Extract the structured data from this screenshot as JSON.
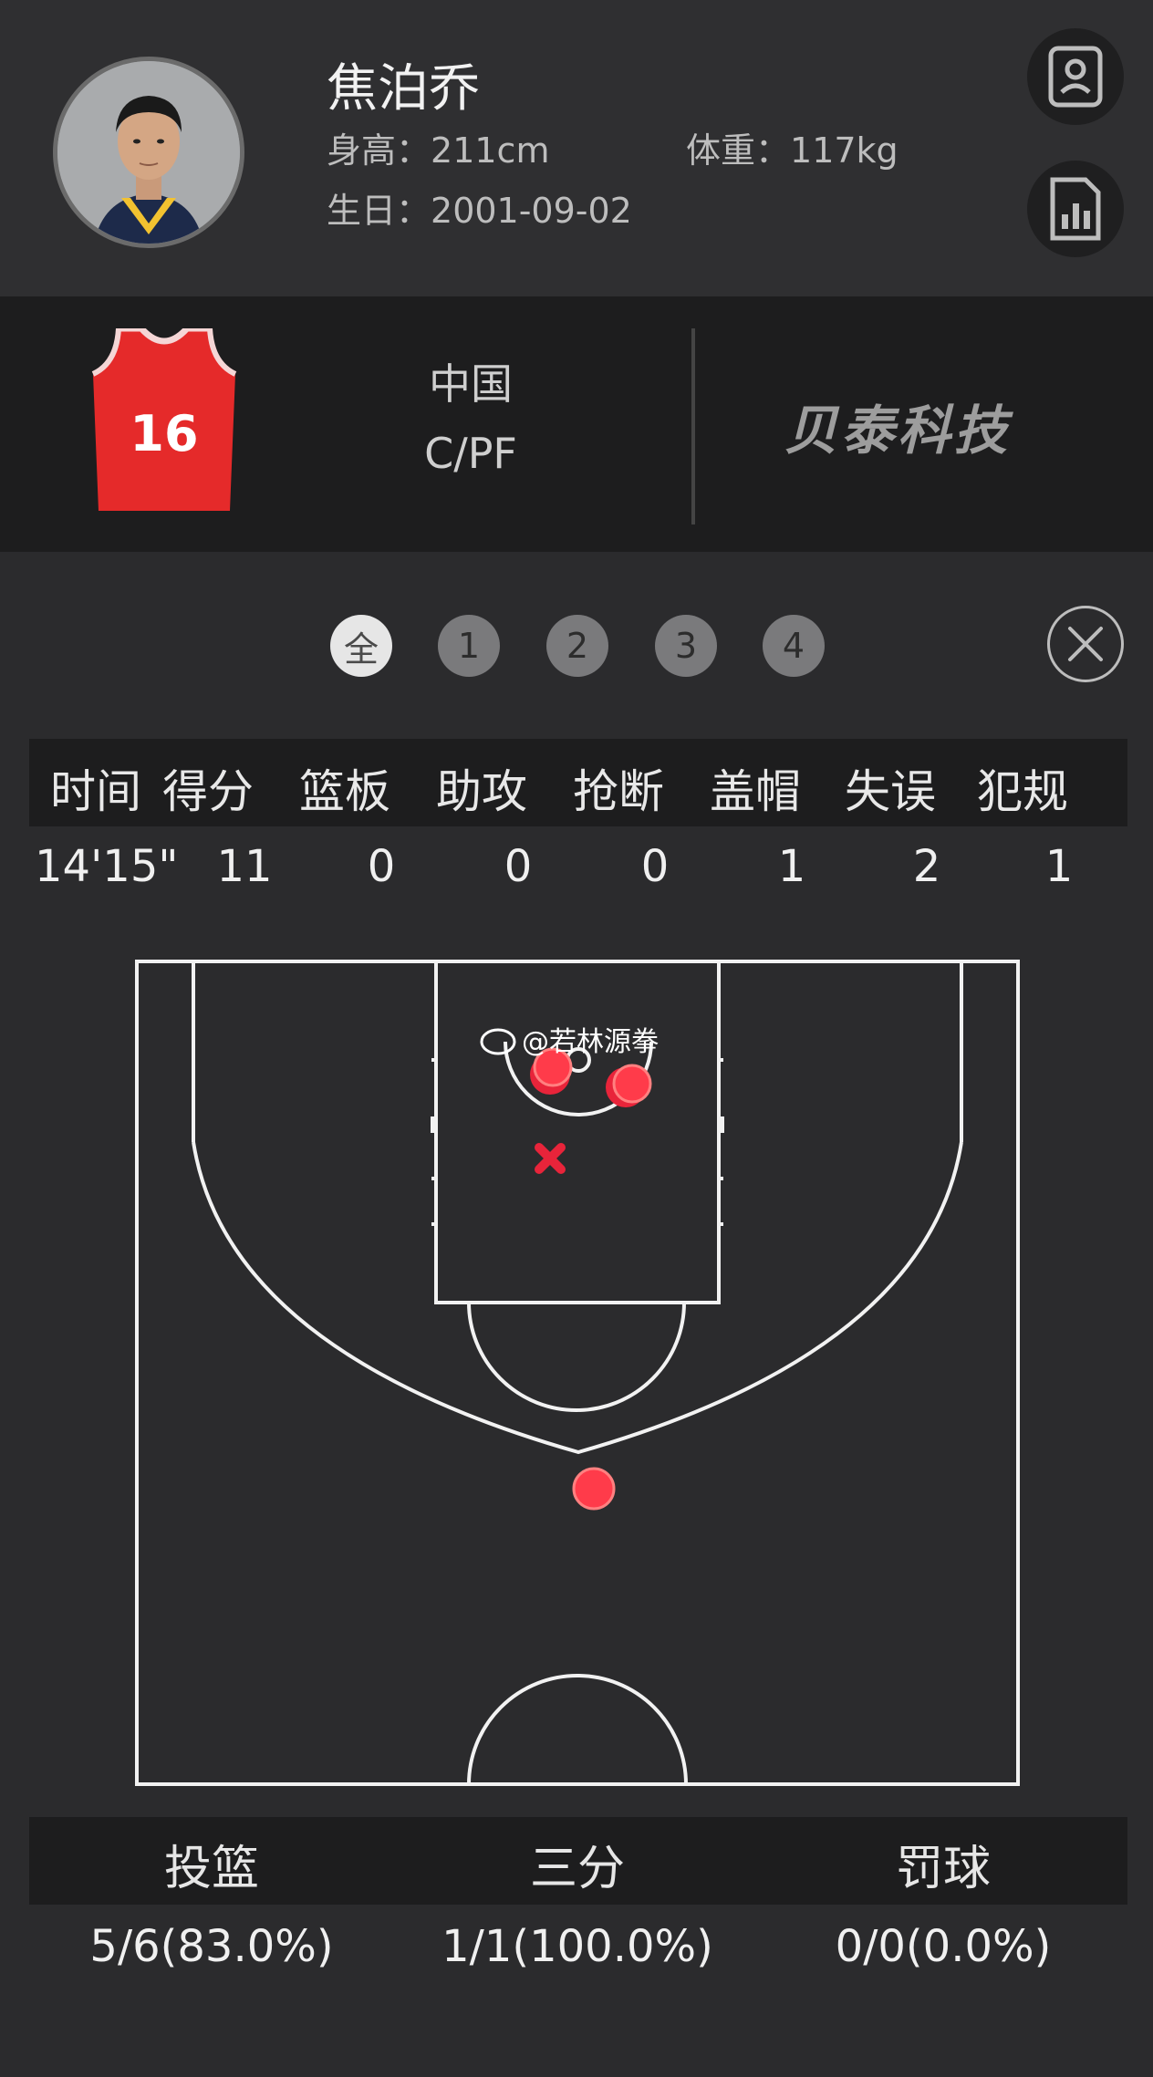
{
  "player": {
    "name": "焦泊乔",
    "height_label": "身高：",
    "height": "211cm",
    "weight_label": "体重：",
    "weight": "117kg",
    "birthday_label": "生日：",
    "birthday": "2001-09-02",
    "jersey_number": "16",
    "country": "中国",
    "position": "C/PF"
  },
  "brand": "贝泰科技",
  "quarter_tabs": [
    "全",
    "1",
    "2",
    "3",
    "4"
  ],
  "active_tab": "全",
  "stats": {
    "headers": [
      "时间",
      "得分",
      "篮板",
      "助攻",
      "抢断",
      "盖帽",
      "失误",
      "犯规"
    ],
    "values": [
      "14'15\"",
      "11",
      "0",
      "0",
      "0",
      "1",
      "2",
      "1"
    ]
  },
  "watermark": "@若林源拳",
  "shooting": {
    "headers": [
      "投篮",
      "三分",
      "罚球"
    ],
    "values": [
      "5/6(83.0%)",
      "1/1(100.0%)",
      "0/0(0.0%)"
    ]
  },
  "colors": {
    "made_shot": "#ff3b4a",
    "missed_shot": "#e8243a",
    "jersey": "#e52a2a"
  },
  "icons": [
    "profile-card-icon",
    "stats-report-icon",
    "close-icon"
  ]
}
